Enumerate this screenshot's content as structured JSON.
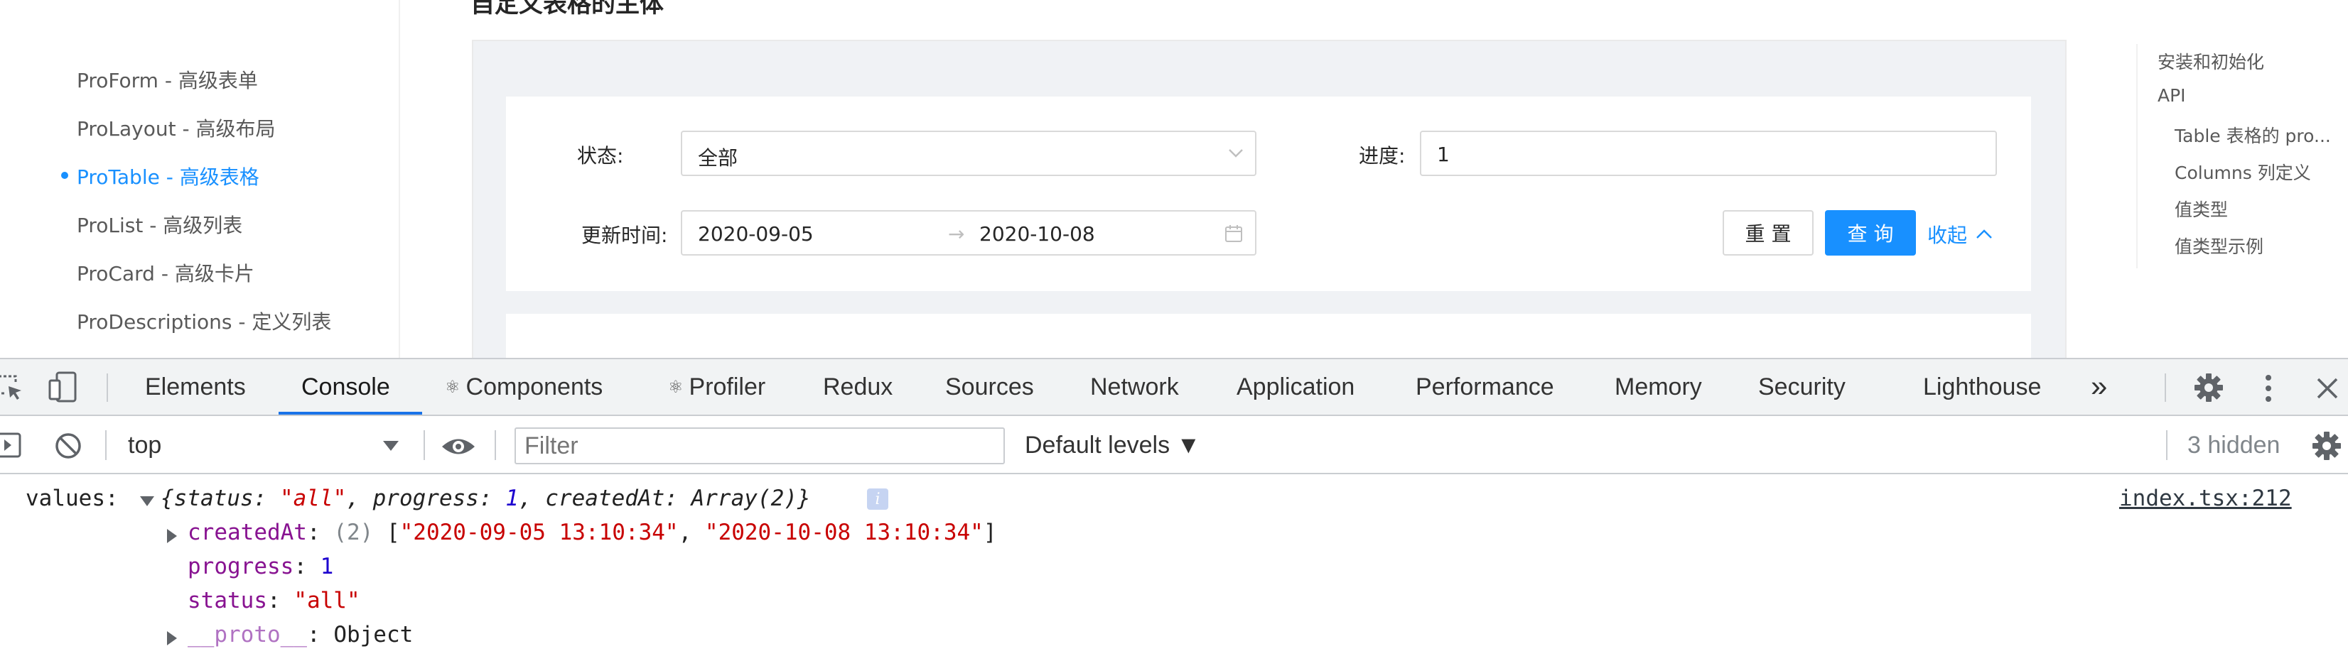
{
  "docs": {
    "page_title": "自定义表格的主体",
    "nav": [
      {
        "label": "ProForm - 高级表单",
        "active": false
      },
      {
        "label": "ProLayout - 高级布局",
        "active": false
      },
      {
        "label": "ProTable - 高级表格",
        "active": true
      },
      {
        "label": "ProList - 高级列表",
        "active": false
      },
      {
        "label": "ProCard - 高级卡片",
        "active": false
      },
      {
        "label": "ProDescriptions - 定义列表",
        "active": false
      }
    ],
    "form": {
      "status_label": "状态:",
      "status_value": "全部",
      "progress_label": "进度:",
      "progress_value": "1",
      "updated_label": "更新时间:",
      "date_start": "2020-09-05",
      "date_end": "2020-10-08",
      "reset_label": "重 置",
      "query_label": "查 询",
      "collapse_label": "收起"
    },
    "toc": [
      {
        "label": "安装和初始化",
        "level": 1
      },
      {
        "label": "API",
        "level": 1
      },
      {
        "label": "Table 表格的 pro...",
        "level": 2
      },
      {
        "label": "Columns 列定义",
        "level": 2
      },
      {
        "label": "值类型",
        "level": 2
      },
      {
        "label": "值类型示例",
        "level": 2
      }
    ],
    "colors": {
      "primary": "#1890ff",
      "demo_bg": "#f0f2f5"
    }
  },
  "devtools": {
    "tabs": [
      {
        "label": "Elements",
        "icon": null
      },
      {
        "label": "Console",
        "icon": null,
        "active": true
      },
      {
        "label": "Components",
        "icon": "react-icon"
      },
      {
        "label": "Profiler",
        "icon": "react-icon"
      },
      {
        "label": "Redux",
        "icon": null
      },
      {
        "label": "Sources",
        "icon": null
      },
      {
        "label": "Network",
        "icon": null
      },
      {
        "label": "Application",
        "icon": null
      },
      {
        "label": "Performance",
        "icon": null
      },
      {
        "label": "Memory",
        "icon": null
      },
      {
        "label": "Security",
        "icon": null
      },
      {
        "label": "Lighthouse",
        "icon": null
      }
    ],
    "more_tabs": "»",
    "toolbar": {
      "context": "top",
      "filter_placeholder": "Filter",
      "levels": "Default levels ▼",
      "hidden": "3 hidden"
    },
    "console": {
      "source_link": "index.tsx:212",
      "line1_prefix": "values: ",
      "line1_summary_open": "{",
      "status_key": "status",
      "status_val": "\"all\"",
      "progress_key": "progress",
      "progress_val": "1",
      "createdAt_key": "createdAt",
      "createdAt_summary": "Array(2)",
      "summary_close": "}",
      "info_badge": "i",
      "createdAt_len": "(2)",
      "date1": "\"2020-09-05 13:10:34\"",
      "date2": "\"2020-10-08 13:10:34\"",
      "proto_key": "__proto__",
      "proto_val": "Object"
    }
  }
}
